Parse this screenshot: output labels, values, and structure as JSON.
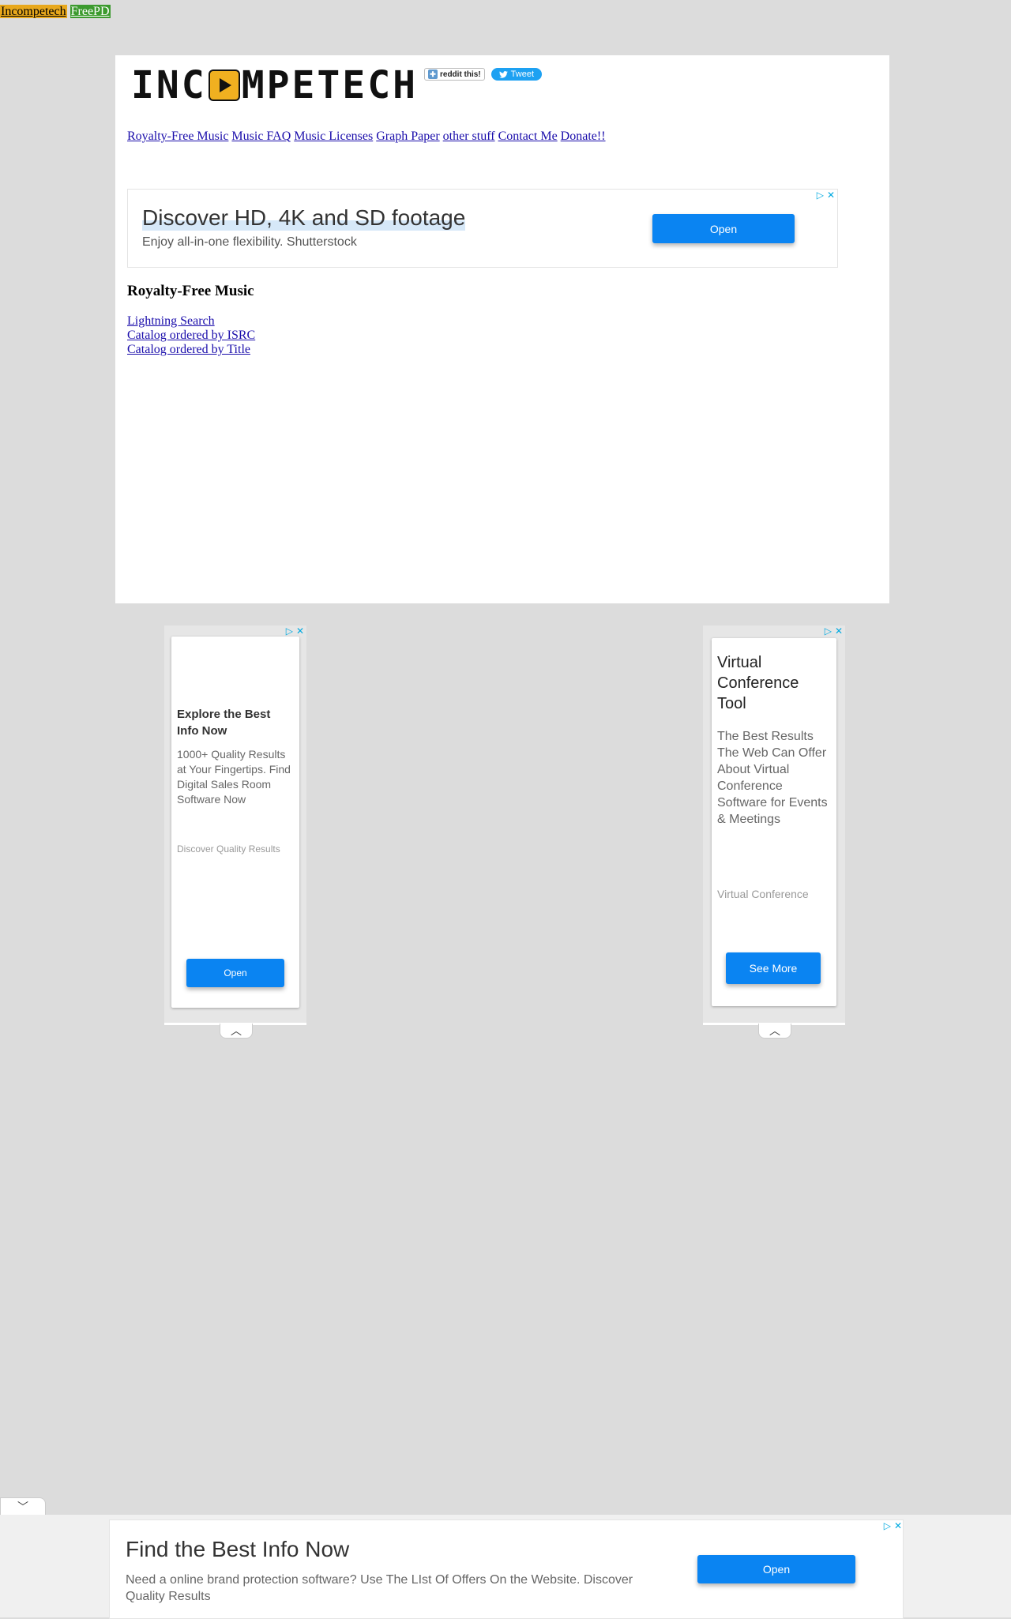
{
  "topbar": {
    "links": [
      "Incompetech",
      "FreePD"
    ]
  },
  "logo": {
    "left": "INC",
    "right": "MPETECH"
  },
  "share": {
    "reddit": "reddit this!",
    "tweet": "Tweet"
  },
  "nav": [
    "Royalty-Free Music",
    "Music FAQ",
    "Music Licenses",
    "Graph Paper",
    "other stuff",
    "Contact Me",
    "Donate!!"
  ],
  "ad_top": {
    "headline": "Discover HD, 4K and SD footage",
    "subline": "Enjoy all-in-one flexibility. Shutterstock",
    "button": "Open"
  },
  "section": {
    "title": "Royalty-Free Music",
    "links": [
      "Lightning Search",
      "Catalog ordered by ISRC",
      "Catalog ordered by Title"
    ]
  },
  "side_ad_left": {
    "headline": "Explore the Best Info Now",
    "body": "1000+ Quality Results at Your Fingertips. Find Digital Sales Room Software Now",
    "footer": "Discover Quality Results",
    "button": "Open"
  },
  "side_ad_right": {
    "headline": "Virtual Conference Tool",
    "body": "The Best Results The Web Can Offer About Virtual Conference Software for Events & Meetings",
    "footer": "Virtual Conference",
    "button": "See More"
  },
  "ad_bottom": {
    "headline": "Find the Best Info Now",
    "description": "Need a online brand protection software? Use The LIst Of Offers On the Website. Discover Quality Results",
    "button": "Open"
  },
  "colors": {
    "page_bg": "#dcdcdc",
    "link": "#1a0dab",
    "incompetech_bg": "#e8a81c",
    "freepd_bg": "#3c9a2e",
    "ad_button": "#0a84f2",
    "adchoices": "#00a9e0"
  },
  "icons": [
    "adchoices-icon",
    "close-icon",
    "chevron-up-icon",
    "chevron-down-icon",
    "play-icon",
    "twitter-bird-icon",
    "reddit-icon"
  ]
}
